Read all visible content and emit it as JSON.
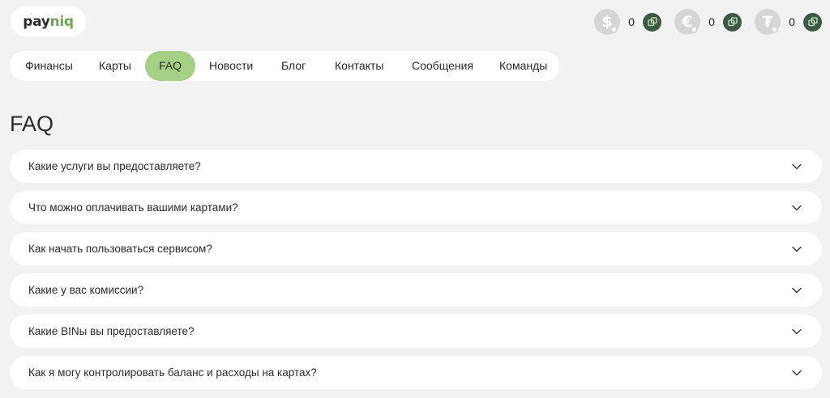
{
  "logo": {
    "part1": "pay",
    "part2": "niq"
  },
  "balances": [
    {
      "symbol": "$",
      "amount": "0",
      "icon": "dollar-icon"
    },
    {
      "symbol": "€",
      "amount": "0",
      "icon": "euro-icon"
    },
    {
      "symbol": "₮",
      "amount": "0",
      "icon": "tether-icon"
    }
  ],
  "nav": {
    "items": [
      "Финансы",
      "Карты",
      "FAQ",
      "Новости",
      "Блог",
      "Контакты",
      "Сообщения",
      "Команды"
    ],
    "active": "FAQ"
  },
  "page": {
    "title": "FAQ"
  },
  "faq": [
    "Какие услуги вы предоставляете?",
    "Что можно оплачивать вашими картами?",
    "Как начать пользоваться сервисом?",
    "Какие у вас комиссии?",
    "Какие BINы вы предоставляете?",
    "Как я могу контролировать баланс и расходы на картах?"
  ],
  "colors": {
    "brand_green": "#6ea94f",
    "active_tab": "#a6cf86",
    "copy_button": "#3b5b43",
    "background": "#f2f2f2"
  }
}
